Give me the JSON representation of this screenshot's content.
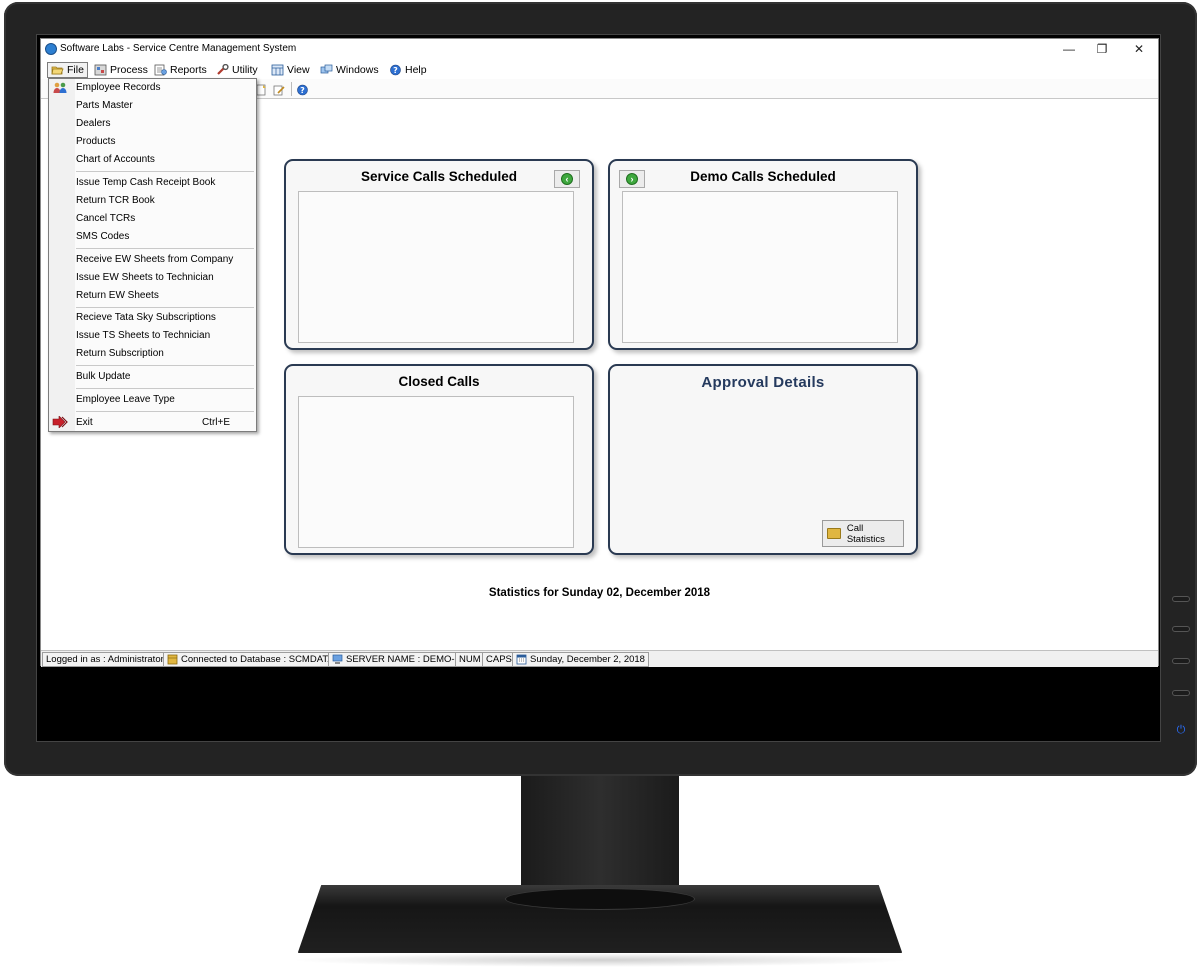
{
  "window": {
    "title": "Software Labs - Service Centre Management System",
    "minimize": "—",
    "restore": "❐",
    "close": "✕"
  },
  "menubar": [
    {
      "label": "File",
      "icon": "folder-open-icon"
    },
    {
      "label": "Process",
      "icon": "process-icon"
    },
    {
      "label": "Reports",
      "icon": "reports-icon"
    },
    {
      "label": "Utility",
      "icon": "wrench-icon"
    },
    {
      "label": "View",
      "icon": "view-icon"
    },
    {
      "label": "Windows",
      "icon": "windows-icon"
    },
    {
      "label": "Help",
      "icon": "help-icon"
    }
  ],
  "file_menu": {
    "items": [
      {
        "label": "Employee Records",
        "icon": "employees-icon"
      },
      {
        "label": "Parts Master"
      },
      {
        "label": "Dealers"
      },
      {
        "label": "Products"
      },
      {
        "label": "Chart of Accounts"
      },
      {
        "label": "Issue Temp Cash Receipt Book"
      },
      {
        "label": "Return TCR Book"
      },
      {
        "label": "Cancel TCRs"
      },
      {
        "label": "SMS Codes"
      },
      {
        "label": "Receive EW Sheets from Company"
      },
      {
        "label": "Issue EW Sheets to Technician"
      },
      {
        "label": "Return EW Sheets"
      },
      {
        "label": "Recieve Tata Sky Subscriptions"
      },
      {
        "label": "Issue TS Sheets to Technician"
      },
      {
        "label": "Return Subscription"
      },
      {
        "label": "Bulk Update"
      },
      {
        "label": "Employee Leave Type"
      },
      {
        "label": "Exit",
        "shortcut": "Ctrl+E",
        "icon": "exit-icon"
      }
    ]
  },
  "panels": {
    "service_calls": {
      "title": "Service Calls Scheduled"
    },
    "demo_calls": {
      "title": "Demo Calls Scheduled"
    },
    "closed_calls": {
      "title": "Closed Calls"
    },
    "approval": {
      "title": "Approval Details",
      "button_label": "Call Statistics"
    }
  },
  "statistics_line": "Statistics for Sunday 02, December 2018",
  "statusbar": {
    "logged_in": "Logged in as : Administrator",
    "database": "Connected to Database : SCMDATA",
    "server": "SERVER NAME : DEMO-PC",
    "num": "NUM",
    "caps": "CAPS",
    "date": "Sunday, December 2, 2018"
  },
  "colors": {
    "panel_border": "#2a3a52",
    "approval_title": "#253a5e",
    "arrow_green": "#3ea83e"
  }
}
